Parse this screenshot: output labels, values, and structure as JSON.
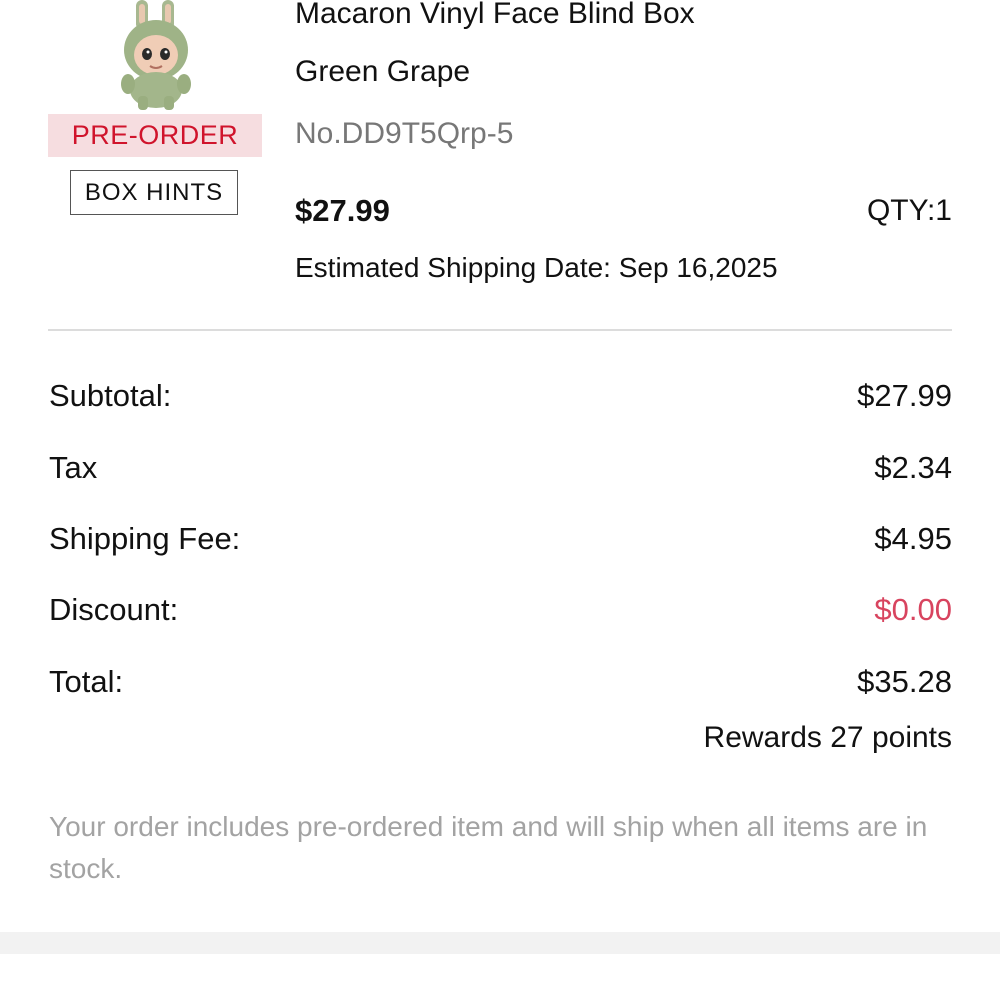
{
  "product": {
    "name": "Macaron Vinyl Face Blind Box",
    "variant": "Green Grape",
    "sku": "No.DD9T5Qrp-5",
    "price": "$27.99",
    "qty_label": "QTY:1",
    "shipping_date": "Estimated Shipping Date: Sep 16,2025",
    "badge": "PRE-ORDER",
    "hints_button": "BOX HINTS",
    "image_icon": "plush-figure-image"
  },
  "summary": {
    "rows": [
      {
        "label": "Subtotal:",
        "value": "$27.99"
      },
      {
        "label": "Tax",
        "value": "$2.34"
      },
      {
        "label": "Shipping Fee:",
        "value": "$4.95"
      },
      {
        "label": "Discount:",
        "value": "$0.00"
      },
      {
        "label": "Total:",
        "value": "$35.28"
      }
    ],
    "rewards": "Rewards 27 points"
  },
  "notice": "Your order includes pre-ordered item and will ship when all items are in stock.",
  "colors": {
    "preorder_text": "#d0142c",
    "preorder_bg": "#f6dde0",
    "discount": "#d8445f",
    "muted": "#a3a3a3"
  }
}
